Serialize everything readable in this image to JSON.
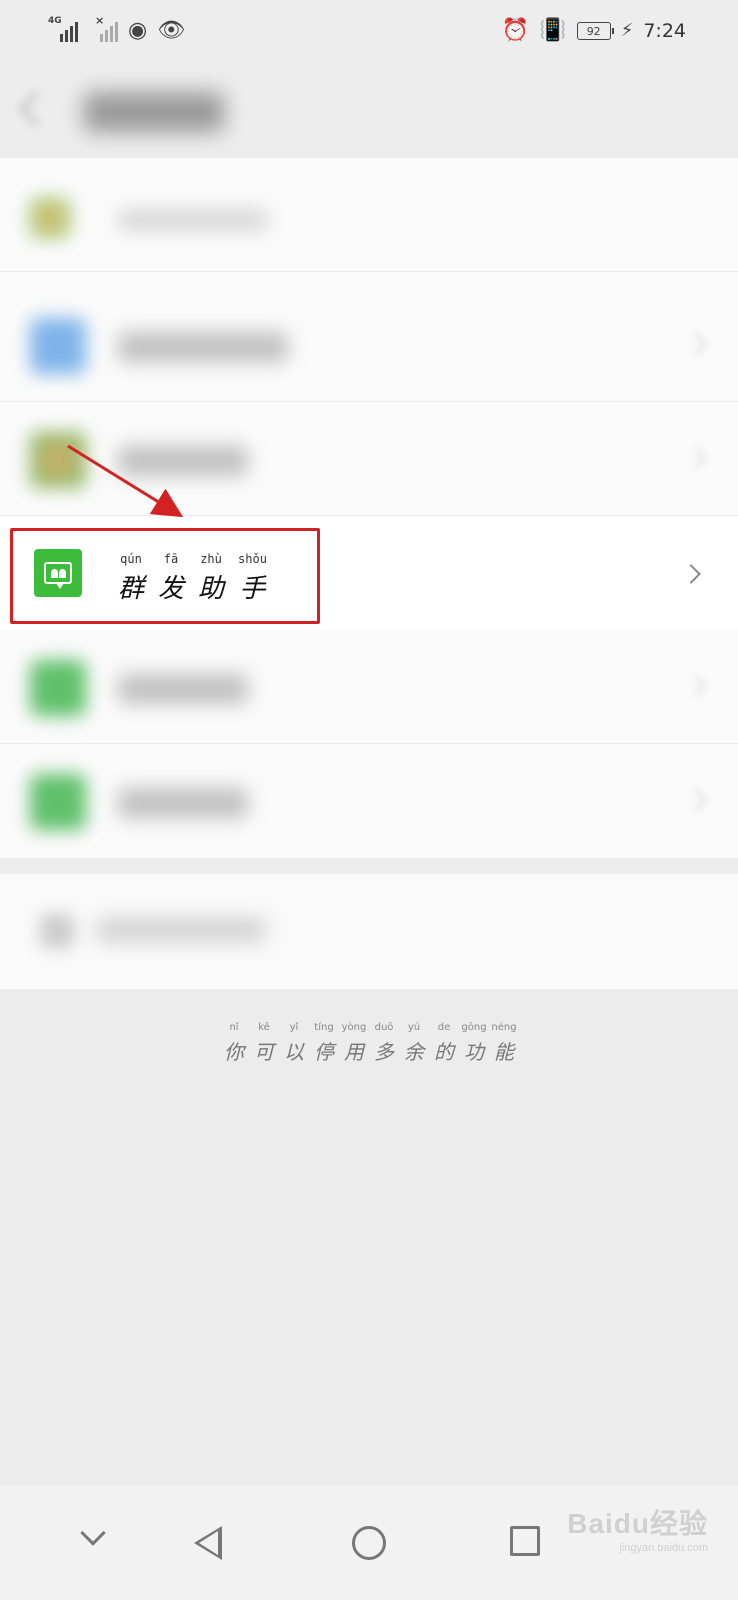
{
  "status_bar": {
    "network_label": "4G",
    "battery_level": "92",
    "time": "7:24"
  },
  "highlighted_item": {
    "label_pinyin": [
      "qún",
      "fā",
      "zhù",
      "shǒu"
    ],
    "label_chars": [
      "群",
      "发",
      "助",
      "手"
    ],
    "icon": "group-message-icon",
    "icon_color": "#3dbb3a"
  },
  "footer_hint": {
    "pinyin": [
      "nǐ",
      "kě",
      "yǐ",
      "tíng",
      "yòng",
      "duō",
      "yú",
      "de",
      "gōng",
      "néng"
    ],
    "chars": [
      "你",
      "可",
      "以",
      "停",
      "用",
      "多",
      "余",
      "的",
      "功",
      "能"
    ]
  },
  "annotation": {
    "box_color": "#d42222",
    "arrow_color": "#d42222"
  },
  "watermark": {
    "main": "Baidu经验",
    "sub": "jingyan.baidu.com"
  }
}
